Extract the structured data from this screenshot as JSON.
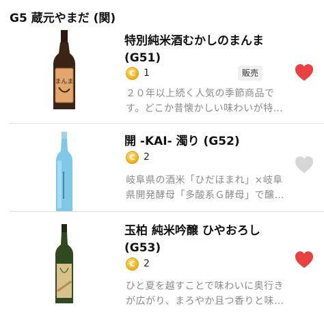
{
  "section": {
    "title": "G5 蔵元やまだ (関)"
  },
  "items": [
    {
      "name": "特別純米酒むかしのまんま (G51)",
      "points": "1",
      "badge": "販売",
      "desc_line1": "２０年以上続く人気の季節商品で",
      "desc_line2": "す。どこか昔懐かしい味わいが特…",
      "favorited": true,
      "label_text": "まんま"
    },
    {
      "name": "開 -KAI- 濁り (G52)",
      "points": "2",
      "desc_line1": "岐阜県の酒米「ひだほまれ」×岐阜",
      "desc_line2": "県開発酵母「多酸系Ｇ酵母」で醸…",
      "favorited": false
    },
    {
      "name": "玉柏 純米吟醸 ひやおろし (G53)",
      "points": "2",
      "desc_line1": "ひと夏を越すことで味わいに奥行き",
      "desc_line2": "が広がり、まろやか且つ香りと味…",
      "favorited": true
    }
  ],
  "icons": {
    "coin": "coin-icon",
    "heart": "heart-icon"
  },
  "colors": {
    "heart_active": "#e9413f",
    "heart_inactive": "#d6d6d6",
    "coin": "#f2b61c"
  }
}
